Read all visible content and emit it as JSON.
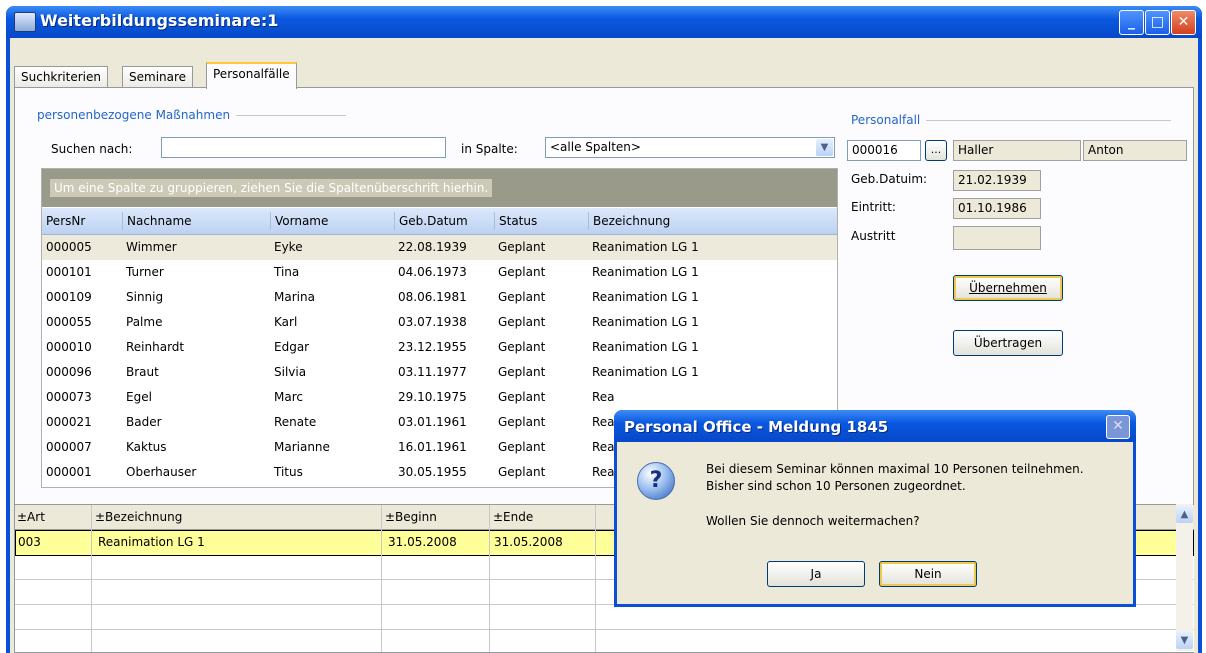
{
  "window": {
    "title": "Weiterbildungsseminare:1"
  },
  "tabs": [
    {
      "label": "Suchkriterien"
    },
    {
      "label": "Seminare"
    },
    {
      "label": "Personalfälle"
    }
  ],
  "search": {
    "group_title": "personenbezogene Maßnahmen",
    "search_label": "Suchen nach:",
    "search_value": "",
    "column_label": "in Spalte:",
    "column_value": "<alle Spalten>"
  },
  "grid": {
    "group_hint": "Um eine Spalte zu gruppieren, ziehen Sie die Spaltenüberschrift hierhin.",
    "columns": [
      "PersNr",
      "Nachname",
      "Vorname",
      "Geb.Datum",
      "Status",
      "Bezeichnung"
    ],
    "rows": [
      [
        "000005",
        "Wimmer",
        "Eyke",
        "22.08.1939",
        "Geplant",
        "Reanimation LG 1"
      ],
      [
        "000101",
        "Turner",
        "Tina",
        "04.06.1973",
        "Geplant",
        "Reanimation LG 1"
      ],
      [
        "000109",
        "Sinnig",
        "Marina",
        "08.06.1981",
        "Geplant",
        "Reanimation LG 1"
      ],
      [
        "000055",
        "Palme",
        "Karl",
        "03.07.1938",
        "Geplant",
        "Reanimation LG 1"
      ],
      [
        "000010",
        "Reinhardt",
        "Edgar",
        "23.12.1955",
        "Geplant",
        "Reanimation LG 1"
      ],
      [
        "000096",
        "Braut",
        "Silvia",
        "03.11.1977",
        "Geplant",
        "Reanimation LG 1"
      ],
      [
        "000073",
        "Egel",
        "Marc",
        "29.10.1975",
        "Geplant",
        "Rea"
      ],
      [
        "000021",
        "Bader",
        "Renate",
        "03.01.1961",
        "Geplant",
        "Rea"
      ],
      [
        "000007",
        "Kaktus",
        "Marianne",
        "16.01.1961",
        "Geplant",
        "Rea"
      ],
      [
        "000001",
        "Oberhauser",
        "Titus",
        "30.05.1955",
        "Geplant",
        "Rea"
      ]
    ]
  },
  "personalfall": {
    "group_title": "Personalfall",
    "persnr": "000016",
    "browse_label": "...",
    "nachname": "Haller",
    "vorname": "Anton",
    "geb_label": "Geb.Datuim:",
    "geb_value": "21.02.1939",
    "eintritt_label": "Eintritt:",
    "eintritt_value": "01.10.1986",
    "austritt_label": "Austritt",
    "austritt_value": "",
    "uebernehmen_label": "Übernehmen",
    "uebertragen_label": "Übertragen"
  },
  "lower_grid": {
    "columns": [
      "±Art",
      "±Bezeichnung",
      "±Beginn",
      "±Ende"
    ],
    "rows": [
      [
        "003",
        "Reanimation LG 1",
        "31.05.2008",
        "31.05.2008"
      ]
    ]
  },
  "dialog": {
    "title": "Personal Office - Meldung 1845",
    "line1": "Bei diesem Seminar können maximal 10 Personen teilnehmen.",
    "line2": "Bisher sind schon 10 Personen zugeordnet.",
    "line3": "Wollen Sie dennoch weitermachen?",
    "yes_label": "Ja",
    "no_label": "Nein",
    "icon": "question-icon"
  },
  "colors": {
    "titlebar": "#0a58e0",
    "selected_row": "#ffff99",
    "tab_accent": "#ffc83c"
  }
}
